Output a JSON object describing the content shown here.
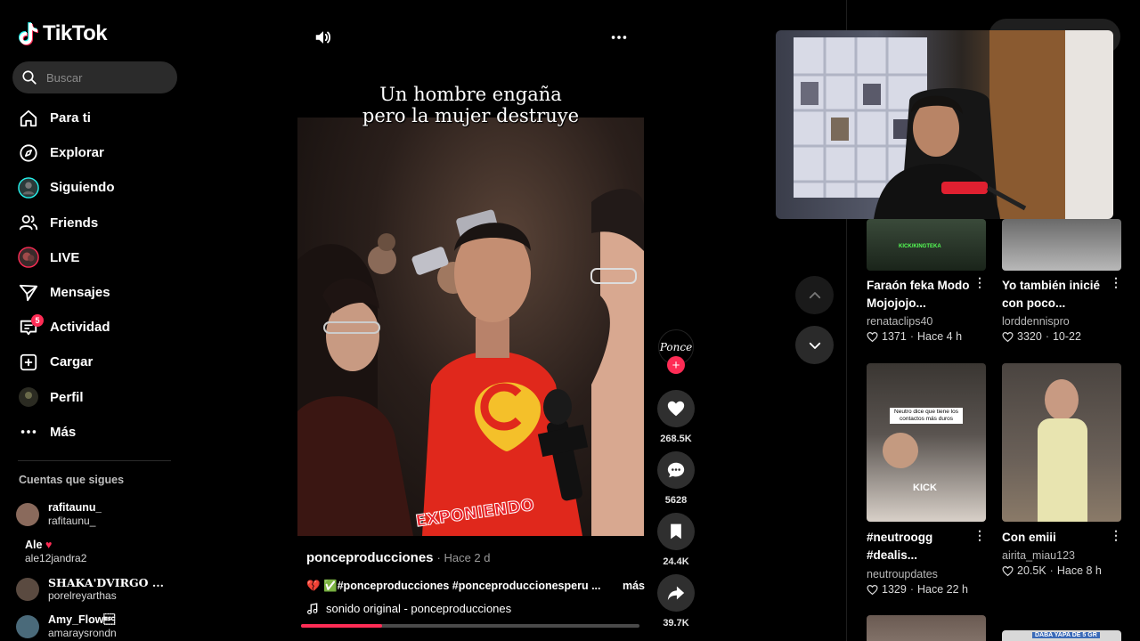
{
  "app": {
    "name": "TikTok"
  },
  "search": {
    "placeholder": "Buscar"
  },
  "nav": [
    {
      "label": "Para ti",
      "icon": "home-icon"
    },
    {
      "label": "Explorar",
      "icon": "compass-icon"
    },
    {
      "label": "Siguiendo",
      "icon": "following-avatar-icon"
    },
    {
      "label": "Friends",
      "icon": "friends-icon"
    },
    {
      "label": "LIVE",
      "icon": "live-avatar-icon"
    },
    {
      "label": "Mensajes",
      "icon": "send-icon"
    },
    {
      "label": "Actividad",
      "icon": "activity-icon",
      "badge": "5"
    },
    {
      "label": "Cargar",
      "icon": "upload-icon"
    },
    {
      "label": "Perfil",
      "icon": "profile-avatar-icon"
    },
    {
      "label": "Más",
      "icon": "more-icon"
    }
  ],
  "following": {
    "title": "Cuentas que sigues",
    "accounts": [
      {
        "name": "rafitaunu_",
        "handle": "rafitaunu_",
        "color": "#8a6a5c"
      },
      {
        "name": "Ale",
        "handle": "ale12jandra2",
        "color": "#000000",
        "heart": "♥"
      },
      {
        "name": "SHAKA'DVIRGO ...",
        "handle": "porelreyarthas",
        "color": "#5a4a40"
      },
      {
        "name": "Amy_Flow\u001b",
        "handle": "amaraysrondn",
        "color": "#4a6a7a"
      }
    ]
  },
  "video": {
    "title_line1": "Un hombre engaña",
    "title_line2": "pero la mujer destruye",
    "watermark": "EXPONIENDO",
    "author": "ponceproducciones",
    "time": "· Hace 2 d",
    "description": "💔 ✅#ponceproducciones #ponceproduccionesperu ...",
    "more": "más",
    "sound": "sonido original - ponceproducciones",
    "progress": 0.24,
    "creator_badge": "Ponce",
    "likes": "268.5K",
    "comments": "5628",
    "saves": "24.4K",
    "shares": "39.7K"
  },
  "feed": [
    {
      "title_line1": "Faraón feka Modo",
      "title_line2": "Mojojojo...",
      "user": "renataclips40",
      "likes": "1371",
      "time": "Hace 4 h",
      "thumb_text": "KICK/KINGTEKA"
    },
    {
      "title_line1": "Yo también inicié",
      "title_line2": "con poco...",
      "user": "lorddennispro",
      "likes": "3320",
      "time": "10-22",
      "thumb_text": ""
    },
    {
      "title_line1": "#neutroogg",
      "title_line2": "#dealis...",
      "user": "neutroupdates",
      "likes": "1329",
      "time": "Hace 22 h",
      "thumb_text": "Neutro dice que tiene los contactos más duros",
      "thumb_text2": "KICK"
    },
    {
      "title_line1": "Con emiii",
      "title_line2": "",
      "user": "airita_miau123",
      "likes": "20.5K",
      "time": "Hace 8 h",
      "thumb_text": ""
    },
    {
      "thumb_text": "DABA YAPA DE 5 GR"
    }
  ],
  "colors": {
    "accent": "#fe2c55",
    "bg": "#000000",
    "btn": "#2f2f2f"
  }
}
